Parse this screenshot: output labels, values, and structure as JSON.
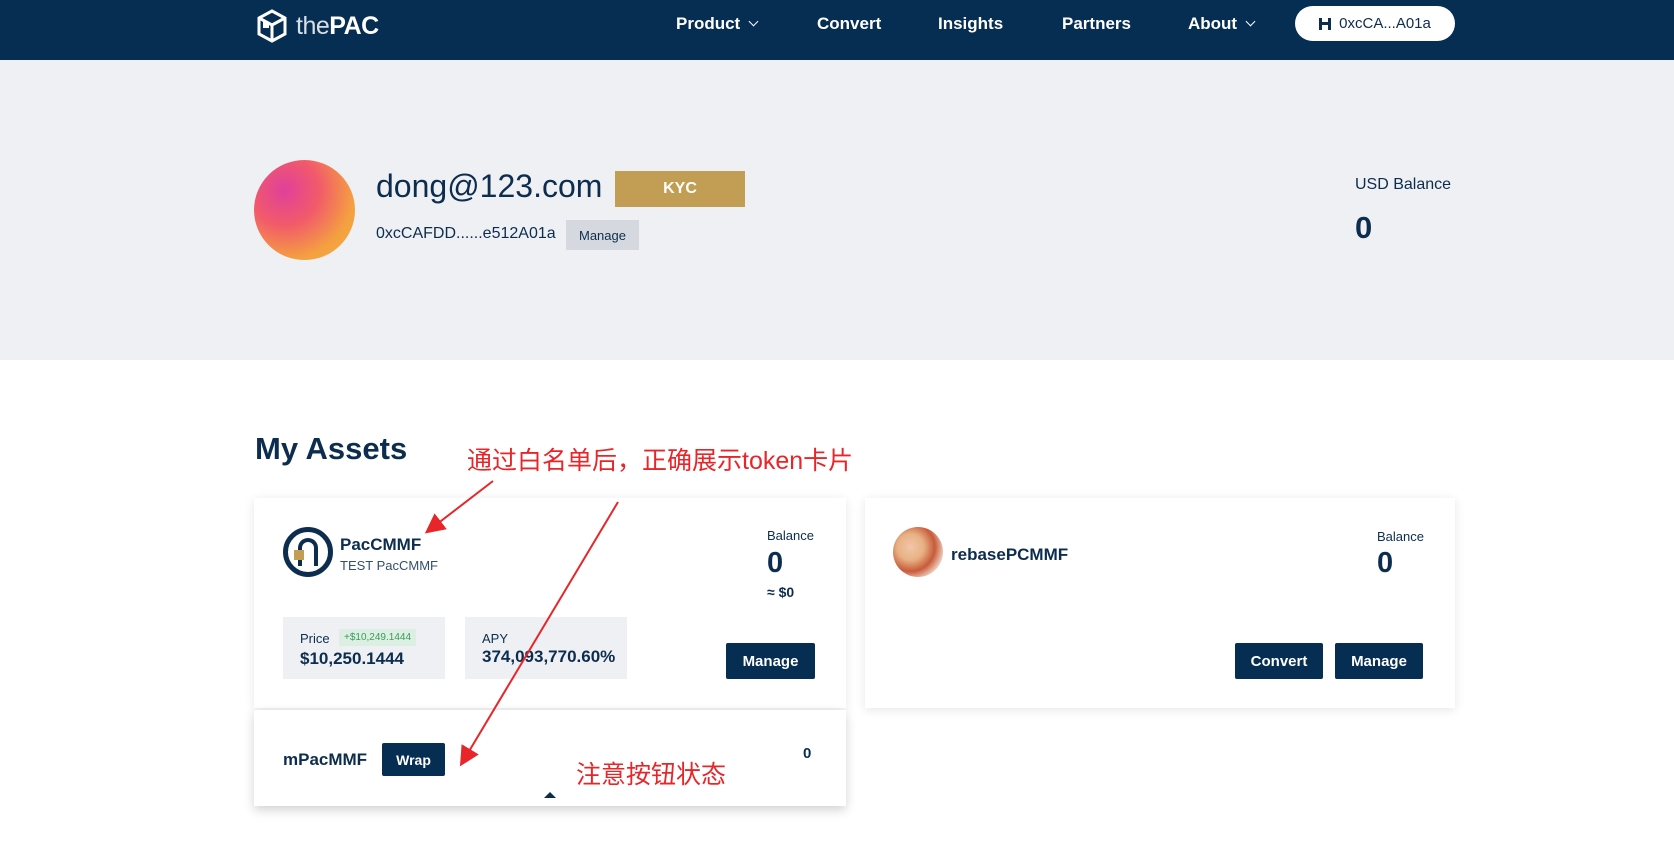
{
  "nav": {
    "logo_the": "the",
    "logo_pac": "PAC",
    "items": [
      {
        "label": "Product",
        "dropdown": true
      },
      {
        "label": "Convert",
        "dropdown": false
      },
      {
        "label": "Insights",
        "dropdown": false
      },
      {
        "label": "Partners",
        "dropdown": false
      },
      {
        "label": "About",
        "dropdown": true
      }
    ],
    "wallet_label": "0xcCA...A01a",
    "wallet_icon": "wallet-connect-icon"
  },
  "profile": {
    "email": "dong@123.com",
    "kyc_label": "KYC",
    "address": "0xcCAFDD......e512A01a",
    "manage_label": "Manage",
    "usd_balance_label": "USD Balance",
    "usd_balance_value": "0"
  },
  "assets": {
    "title": "My Assets",
    "cards": [
      {
        "name": "PacCMMF",
        "subtitle": "TEST PacCMMF",
        "balance_label": "Balance",
        "balance_value": "0",
        "balance_usd": "≈ $0",
        "price_label": "Price",
        "price_delta": "+$10,249.1444",
        "price_value": "$10,250.1444",
        "apy_label": "APY",
        "apy_value": "374,093,770.60%",
        "manage_label": "Manage",
        "sub_token": {
          "name": "mPacMMF",
          "wrap_label": "Wrap",
          "balance_value": "0"
        }
      },
      {
        "name": "rebasePCMMF",
        "balance_label": "Balance",
        "balance_value": "0",
        "convert_label": "Convert",
        "manage_label": "Manage"
      }
    ]
  },
  "annotations": {
    "top": "通过白名单后，正确展示token卡片",
    "bottom": "注意按钮状态",
    "color": "#e8262a"
  },
  "colors": {
    "navy": "#062d52",
    "gold": "#c29d54",
    "band": "#eff0f3"
  }
}
